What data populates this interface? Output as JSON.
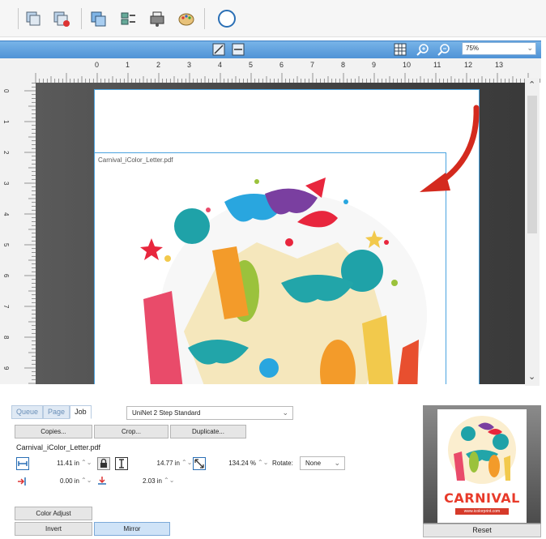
{
  "toolbar": {
    "icons": [
      "layers-icon",
      "layers-delete-icon",
      "layers-add-icon",
      "image-list-icon",
      "printer-driver-icon",
      "color-palette-icon",
      "compass-icon"
    ]
  },
  "viewbar": {
    "zoom_value": "75%"
  },
  "ruler": {
    "top_labels": [
      "0",
      "1",
      "2",
      "3",
      "4",
      "5",
      "6",
      "7",
      "8",
      "9",
      "10",
      "11",
      "12",
      "13"
    ],
    "left_labels": [
      "0",
      "1",
      "2",
      "3",
      "4",
      "5",
      "6",
      "7",
      "8",
      "9"
    ]
  },
  "canvas": {
    "filename": "Carnival_iColor_Letter.pdf"
  },
  "panel": {
    "tabs": [
      "Queue",
      "Page",
      "Job"
    ],
    "active_tab": "Job",
    "profile": "UniNet 2 Step Standard",
    "copies_label": "Copies...",
    "crop_label": "Crop...",
    "duplicate_label": "Duplicate...",
    "filename": "Carnival_iColor_Letter.pdf",
    "width_value": "11.41 in",
    "height_value": "14.77 in",
    "scale_value": "134.24 %",
    "rotate_label": "Rotate:",
    "rotate_value": "None",
    "offset_x_value": "0.00 in",
    "offset_y_value": "2.03 in",
    "color_adjust_label": "Color Adjust",
    "invert_label": "Invert",
    "mirror_label": "Mirror"
  },
  "preview": {
    "title_text": "CARNIVAL",
    "site_text": "www.icolorprint.com",
    "reset_label": "Reset"
  },
  "colors": {
    "accent_blue": "#4f93d6",
    "annotation_arrow": "#d42a1e"
  }
}
